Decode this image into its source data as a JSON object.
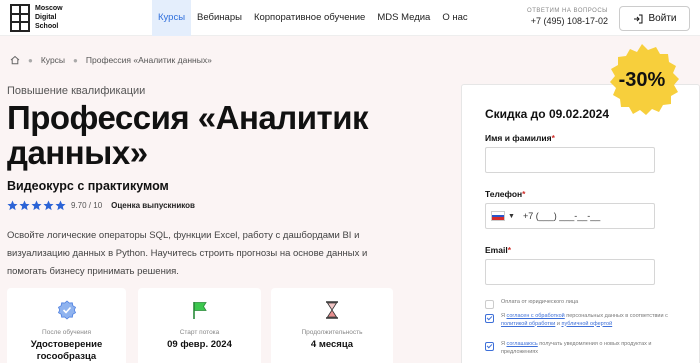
{
  "header": {
    "logo_lines": [
      "Moscow",
      "Digital",
      "School"
    ],
    "nav": [
      {
        "label": "Курсы",
        "active": true
      },
      {
        "label": "Вебинары",
        "active": false
      },
      {
        "label": "Корпоративное обучение",
        "active": false
      },
      {
        "label": "MDS Медиа",
        "active": false
      },
      {
        "label": "О нас",
        "active": false
      }
    ],
    "contact_label": "ОТВЕТИМ НА ВОПРОСЫ",
    "phone": "+7 (495) 108-17-02",
    "login_label": "Войти"
  },
  "breadcrumb": {
    "items": [
      "Курсы",
      "Профессия «Аналитик данных»"
    ]
  },
  "hero": {
    "subtitle": "Повышение квалификации",
    "title_line1": "Профессия «Аналитик",
    "title_line2": "данных»",
    "course_type": "Видеокурс с практикумом",
    "rating_value": "9.70 / 10",
    "rating_stars": 5,
    "rating_label": "Оценка выпускников",
    "description": "Освойте логические операторы SQL, функции Excel, работу с дашбордами BI и визуализацию данных в Python. Научитесь строить прогнозы на основе данных и помогать бизнесу принимать решения."
  },
  "cards": [
    {
      "icon": "certificate-badge-icon",
      "label": "После обучения",
      "value_line1": "Удостоверение",
      "value_line2": "госообразца"
    },
    {
      "icon": "flag-icon",
      "label": "Старт потока",
      "value_line1": "09 февр. 2024",
      "value_line2": ""
    },
    {
      "icon": "hourglass-icon",
      "label": "Продолжительность",
      "value_line1": "4 месяца",
      "value_line2": ""
    }
  ],
  "form": {
    "title": "Скидка до 09.02.2024",
    "name_label": "Имя и фамилия",
    "phone_label": "Телефон",
    "phone_placeholder": "+7 (___) ___-__-__",
    "email_label": "Email",
    "check_legal": "Оплата от юридического лица",
    "consent_1_prefix": "Я",
    "consent_1_link1": "согласен с обработкой",
    "consent_1_mid": "персональных данных в соответствии с",
    "consent_1_link2": "политикой обработки",
    "consent_1_and": "и",
    "consent_1_link3": "публичной офертой",
    "consent_2_prefix": "Я",
    "consent_2_link": "соглашаюсь",
    "consent_2_text": "получать уведомления о новых продуктах и предложениях"
  },
  "badge": {
    "text": "-30%"
  },
  "colors": {
    "accent": "#2f6fdc",
    "nav_active_bg": "#e4eefc",
    "star": "#2b63d6",
    "badge": "#f7cf3c",
    "required": "#d0302c",
    "bg": "#fbf4f4"
  }
}
